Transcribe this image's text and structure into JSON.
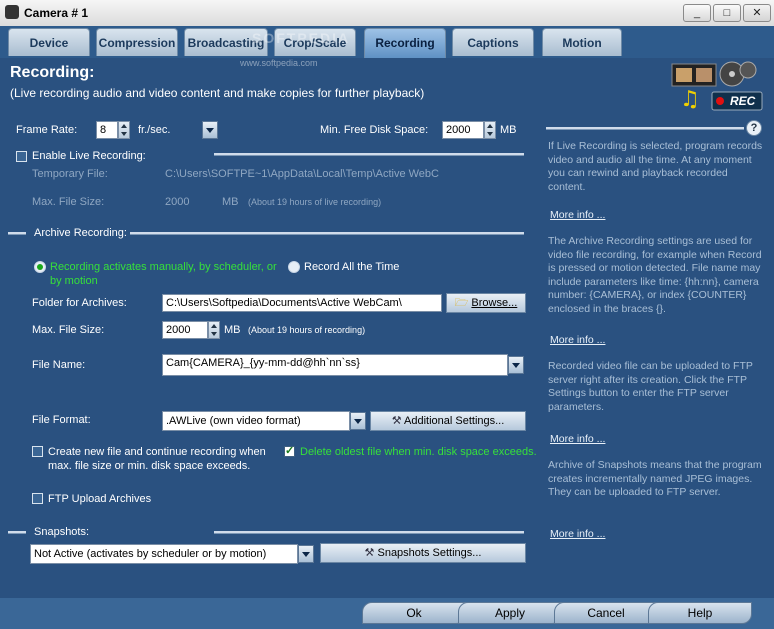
{
  "window": {
    "title": "Camera # 1",
    "min_label": "_",
    "max_label": "□",
    "close_label": "✕"
  },
  "tabs": [
    {
      "label": "Device"
    },
    {
      "label": "Compression"
    },
    {
      "label": "Broadcasting"
    },
    {
      "label": "Crop/Scale"
    },
    {
      "label": "Recording"
    },
    {
      "label": "Captions"
    },
    {
      "label": "Motion"
    }
  ],
  "watermark": {
    "line1": "SOFTPEDIA",
    "line2": "www.softpedia.com"
  },
  "header": {
    "title": "Recording:",
    "subtitle": "(Live recording audio and video content and make copies for further playback)"
  },
  "logo": {
    "rec_label": "REC"
  },
  "frame_rate": {
    "label": "Frame Rate:",
    "value": "8",
    "unit": "fr./sec."
  },
  "disk_space": {
    "label": "Min. Free Disk Space:",
    "value": "2000",
    "unit": "MB"
  },
  "live": {
    "enable_label": "Enable Live Recording:",
    "temp_file_label": "Temporary File:",
    "temp_file_value": "C:\\Users\\SOFTPE~1\\AppData\\Local\\Temp\\Active WebC",
    "max_size_label": "Max. File Size:",
    "max_size_value": "2000",
    "max_size_unit": "MB",
    "max_size_note": "(About 19 hours of live recording)"
  },
  "archive": {
    "section_label": "Archive Recording:",
    "radio_manual": "Recording activates manually, by scheduler, or",
    "radio_manual_2": "by motion",
    "radio_all": "Record All the Time",
    "folder_label": "Folder for Archives:",
    "folder_value": "C:\\Users\\Softpedia\\Documents\\Active WebCam\\",
    "browse_label": "Browse...",
    "max_size_label": "Max. File Size:",
    "max_size_value": "2000",
    "max_size_unit": "MB",
    "max_size_note": "(About 19 hours of recording)",
    "filename_label": "File Name:",
    "filename_value": "Cam{CAMERA}_{yy-mm-dd@hh`nn`ss}",
    "format_label": "File Format:",
    "format_value": ".AWLive (own video format)",
    "additional_label": "Additional Settings...",
    "create_new_label": "Create new file and continue recording when",
    "create_new_label_2": "max. file size or min. disk space exceeds.",
    "delete_oldest_label": "Delete oldest file when min. disk space exceeds.",
    "ftp_label": "FTP Upload Archives"
  },
  "snapshots": {
    "section_label": "Snapshots:",
    "mode_value": "Not Active (activates by scheduler or by motion)",
    "settings_label": "Snapshots Settings..."
  },
  "help": {
    "p1": "If Live Recording is selected, program records video and audio all the time. At any moment you can rewind and playback recorded content.",
    "p2": "The Archive Recording settings are used for video file recording, for example when Record is pressed or motion detected. File name may include parameters like time: {hh:nn}, camera number: {CAMERA}, or index {COUNTER} enclosed in the braces {}.",
    "p3": "Recorded video file can be uploaded to FTP server right after its creation. Click the FTP Settings button to enter the FTP server parameters.",
    "p4": "Archive of Snapshots means that the program creates incrementally named JPEG images. They can be uploaded to FTP server.",
    "more": "More info ..."
  },
  "footer": {
    "ok": "Ok",
    "apply": "Apply",
    "cancel": "Cancel",
    "help": "Help"
  }
}
